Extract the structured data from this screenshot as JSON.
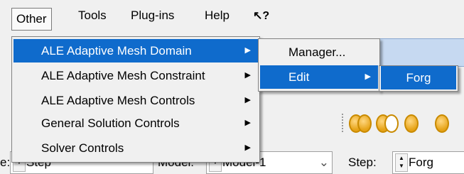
{
  "menubar": {
    "items": [
      {
        "label": "Other",
        "active": true
      },
      {
        "label": "Tools"
      },
      {
        "label": "Plug-ins"
      },
      {
        "label": "Help"
      }
    ],
    "whats_this": "?"
  },
  "menu_other": {
    "items": [
      {
        "label": "ALE Adaptive Mesh Domain",
        "selected": true
      },
      {
        "label": "ALE Adaptive Mesh Constraint"
      },
      {
        "label": "ALE Adaptive Mesh Controls"
      },
      {
        "label": "General Solution Controls"
      },
      {
        "label": "Solver Controls"
      }
    ]
  },
  "submenu_domain": {
    "items": [
      {
        "label": "Manager..."
      },
      {
        "label": "Edit",
        "selected": true
      }
    ]
  },
  "submenu_edit": {
    "items": [
      {
        "label": "Forg",
        "selected": true
      }
    ]
  },
  "context_bar": {
    "left_fragment": "e:",
    "step_combo": "Step",
    "model_label": "Model:",
    "model_value": "Model-1",
    "step_label": "Step:",
    "step_value": "Forg"
  },
  "colors": {
    "selection": "#0f6bcc",
    "menu_bg": "#f0f0f0"
  }
}
